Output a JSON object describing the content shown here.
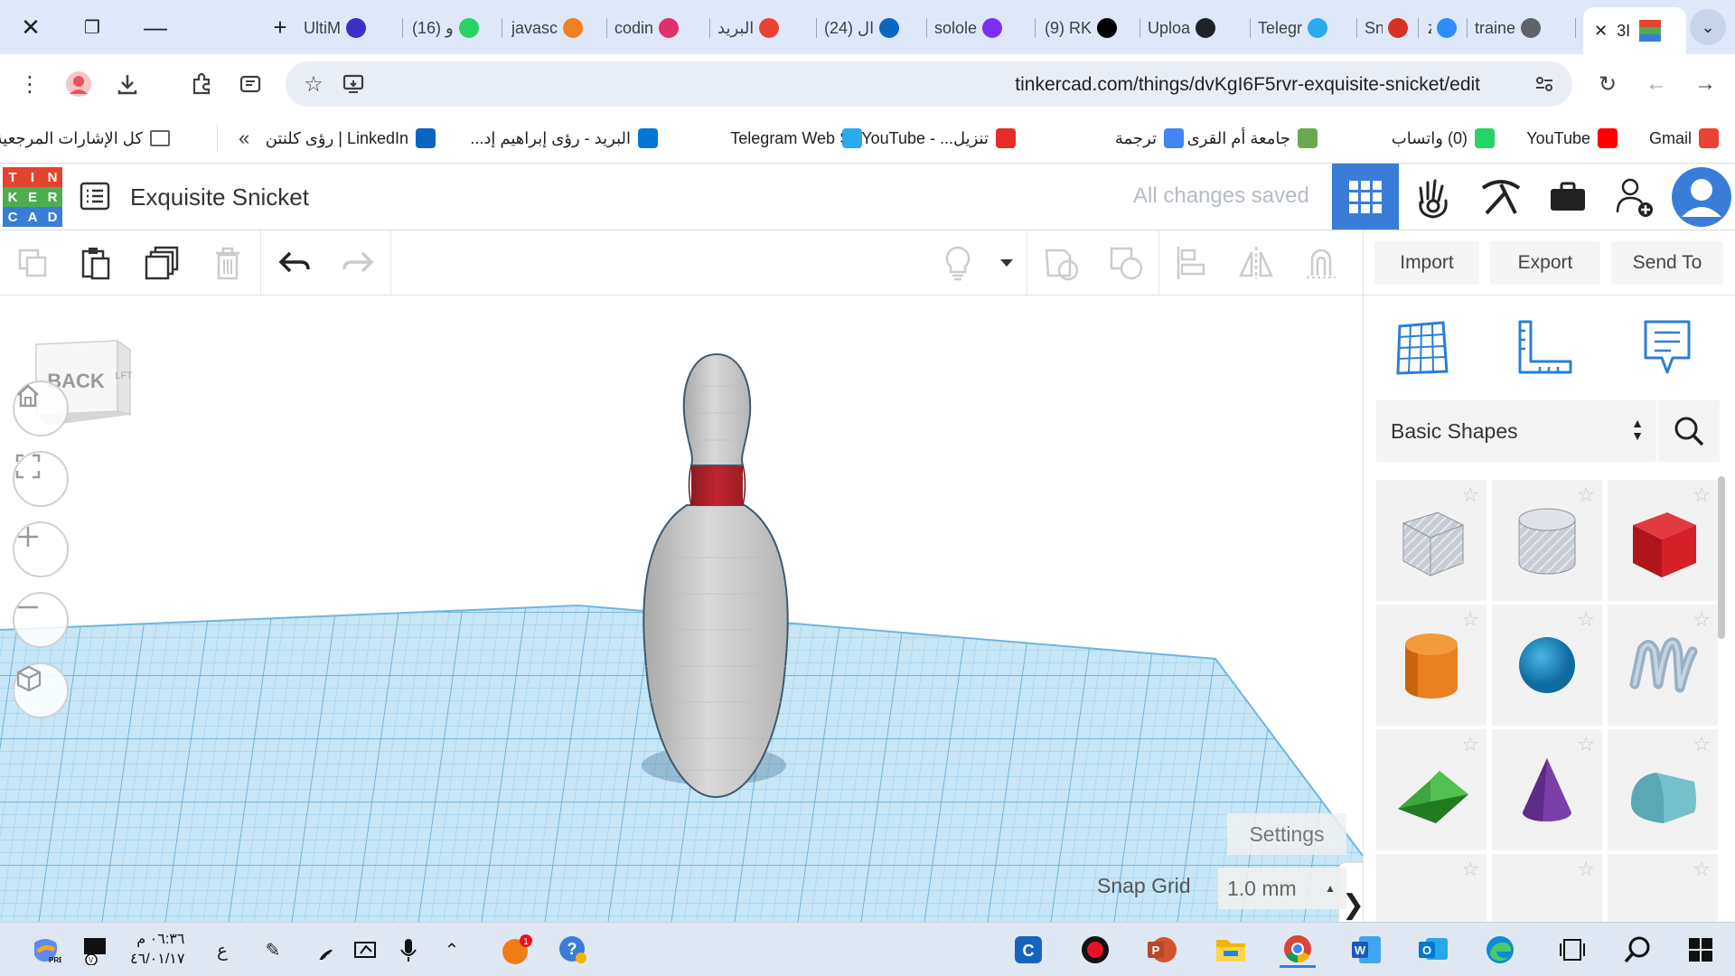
{
  "browser": {
    "tabs": [
      {
        "label": "UltiM",
        "icon": "ultimate-icon",
        "color": "#3b2fc9"
      },
      {
        "label": "(16) و",
        "icon": "whatsapp-icon",
        "color": "#25d366"
      },
      {
        "label": "javasc",
        "icon": "stackoverflow-icon",
        "color": "#f48024"
      },
      {
        "label": "codin",
        "icon": "instagram-icon",
        "color": "#e1306c"
      },
      {
        "label": "البريد",
        "icon": "gmail-icon",
        "color": "#ea4335"
      },
      {
        "label": "(24) ال",
        "icon": "linkedin-icon",
        "color": "#0a66c2"
      },
      {
        "label": "solole",
        "icon": "sololearn-icon",
        "color": "#7b2ff7"
      },
      {
        "label": "(9) RK",
        "icon": "x-icon",
        "color": "#000000"
      },
      {
        "label": "Uploa",
        "icon": "github-icon",
        "color": "#1f2328"
      },
      {
        "label": "Telegr",
        "icon": "telegram-icon",
        "color": "#2aabee"
      },
      {
        "label": "Sn",
        "icon": "record-icon",
        "color": "#d93025"
      },
      {
        "label": "zm",
        "icon": "zoom-icon",
        "color": "#2d8cff"
      },
      {
        "label": "traine",
        "icon": "globe-icon",
        "color": "#5f6368"
      }
    ],
    "active_tab": {
      "label": "3I",
      "icon": "tinkercad-icon"
    },
    "url": "tinkercad.com/things/dvKgI6F5rvr-exquisite-snicket/edit",
    "bookmarks": [
      {
        "label": "Gmail",
        "icon": "gmail-icon",
        "color": "#ea4335"
      },
      {
        "label": "YouTube",
        "icon": "youtube-icon",
        "color": "#ff0000"
      },
      {
        "label": "(0) واتساب",
        "icon": "whatsapp-icon",
        "color": "#25d366"
      },
      {
        "label": "جامعة أم القرى",
        "icon": "university-icon",
        "color": "#6aa84f"
      },
      {
        "label": "ترجمة",
        "icon": "google-translate-icon",
        "color": "#4285f4"
      },
      {
        "label": "تنزيل... - SSYouTube",
        "icon": "ssyoutube-icon",
        "color": "#e52d27"
      },
      {
        "label": "Telegram Web",
        "icon": "telegram-icon",
        "color": "#2aabee"
      },
      {
        "label": "البريد - رؤى إبراهيم إد...",
        "icon": "outlook-icon",
        "color": "#0078d4"
      },
      {
        "label": "LinkedIn | رؤى كلنتن",
        "icon": "linkedin-icon",
        "color": "#0a66c2"
      },
      {
        "label": "كل الإشارات المرجعية",
        "icon": "folder-icon",
        "color": "#5f6368"
      }
    ]
  },
  "tinkercad": {
    "logo_letters": [
      "T",
      "I",
      "N",
      "K",
      "E",
      "R",
      "C",
      "A",
      "D"
    ],
    "logo_colors": [
      "#e2442f",
      "#e2442f",
      "#e2442f",
      "#4cae4f",
      "#4cae4f",
      "#4cae4f",
      "#3a7dd8",
      "#3a7dd8",
      "#3a7dd8"
    ],
    "design_title": "Exquisite Snicket",
    "save_status": "All changes saved",
    "buttons": {
      "import": "Import",
      "export": "Export",
      "send_to": "Send To"
    },
    "view_cube_label": "BACK",
    "view_cube_side": "LFT",
    "settings_label": "Settings",
    "snap_grid_label": "Snap Grid",
    "snap_grid_value": "1.0 mm",
    "shape_library": "Basic Shapes",
    "shapes": [
      {
        "name": "Box Hole",
        "color": "#b8bec8"
      },
      {
        "name": "Cylinder Hole",
        "color": "#b8bec8"
      },
      {
        "name": "Box",
        "color": "#d62027"
      },
      {
        "name": "Cylinder",
        "color": "#e8801f"
      },
      {
        "name": "Sphere",
        "color": "#1a8ac2"
      },
      {
        "name": "Scribble",
        "color": "#9ab0c4"
      },
      {
        "name": "Roof",
        "color": "#3da63d"
      },
      {
        "name": "Cone",
        "color": "#7b3fa8"
      },
      {
        "name": "Round Roof",
        "color": "#74c1cc"
      }
    ],
    "colors": {
      "accent": "#3a7dd8",
      "grid": "#9fd3ef",
      "pin_red": "#b3202a",
      "pin_body": "#d6d6d6"
    }
  },
  "taskbar": {
    "time": "٠٦:٣٦ م",
    "date": "٤٦/٠١/١٧",
    "lang": "ع",
    "notification_badge": "1"
  }
}
